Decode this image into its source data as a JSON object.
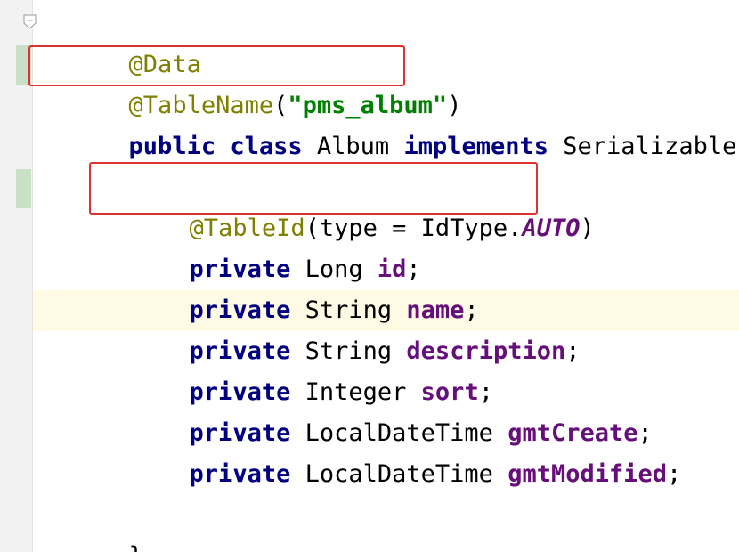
{
  "editor": {
    "language": "Java",
    "colors": {
      "keyword": "#000080",
      "annotation": "#808000",
      "string": "#008000",
      "field": "#660e7a",
      "highlight_box": "#e03131",
      "current_line": "#fffae3",
      "change_marker": "#c9dfc6"
    },
    "lines": {
      "l1": {
        "annotation": "@Data"
      },
      "l2": {
        "annotation": "@TableName",
        "open_paren": "(",
        "string": "\"pms_album\"",
        "close_paren": ")"
      },
      "l3": {
        "kw_public": "public",
        "kw_class": "class",
        "class_name": "Album",
        "kw_implements": "implements",
        "interface_name": "Serializable",
        "brace_open": "{"
      },
      "l5": {
        "annotation": "@TableId",
        "arg_open": "(type = IdType.",
        "const": "AUTO",
        "arg_close": ")"
      },
      "fields": [
        {
          "modifier": "private",
          "type": "Long",
          "name": "id",
          "semicolon": ";"
        },
        {
          "modifier": "private",
          "type": "String",
          "name": "name",
          "semicolon": ";"
        },
        {
          "modifier": "private",
          "type": "String",
          "name": "description",
          "semicolon": ";"
        },
        {
          "modifier": "private",
          "type": "Integer",
          "name": "sort",
          "semicolon": ";"
        },
        {
          "modifier": "private",
          "type": "LocalDateTime",
          "name": "gmtCreate",
          "semicolon": ";"
        },
        {
          "modifier": "private",
          "type": "LocalDateTime",
          "name": "gmtModified",
          "semicolon": ";"
        }
      ],
      "l14": {
        "brace_close": "}"
      }
    }
  }
}
